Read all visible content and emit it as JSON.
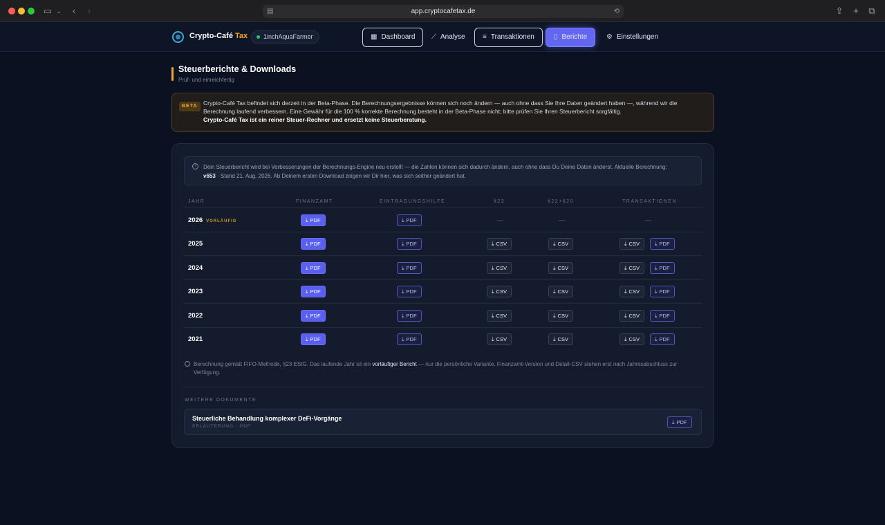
{
  "browser": {
    "url": "app.cryptocafetax.de"
  },
  "nav": {
    "brand": "Crypto-Café",
    "brand_suffix": "Tax",
    "user": "1inchAquaFarmer",
    "items": [
      {
        "label": "Dashboard",
        "icon": "grid-icon",
        "state": "outline"
      },
      {
        "label": "Analyse",
        "icon": "chart-icon",
        "state": "plain"
      },
      {
        "label": "Transaktionen",
        "icon": "list-icon",
        "state": "outline"
      },
      {
        "label": "Berichte",
        "icon": "document-icon",
        "state": "active"
      },
      {
        "label": "Einstellungen",
        "icon": "gear-icon",
        "state": "plain"
      }
    ]
  },
  "page": {
    "title": "Steuerberichte & Downloads",
    "subtitle": "Prüf- und einreichfertig"
  },
  "beta": {
    "badge": "BETA",
    "text": "Crypto-Café Tax befindet sich derzeit in der Beta-Phase. Die Berechnungsergebnisse können sich noch ändern — auch ohne dass Sie Ihre Daten geändert haben —, während wir die Berechnung laufend verbessern. Eine Gewähr für die 100 % korrekte Berechnung besteht in der Beta-Phase nicht; bitte prüfen Sie Ihren Steuerbericht sorgfältig.",
    "strong": "Crypto-Café Tax ist ein reiner Steuer-Rechner und ersetzt keine Steuerberatung."
  },
  "info": {
    "text1": "Dein Steuerbericht wird bei Verbesserungen der Berechnungs-Engine neu erstellt — die Zahlen können sich dadurch ändern, auch ohne dass Du Deine Daten änderst. Aktuelle Berechnung:",
    "version": "v653",
    "text2": " · Stand 21. Aug. 2026. Ab Deinem ersten Download zeigen wir Dir hier, was sich seither geändert hat."
  },
  "table": {
    "headers": {
      "year": "JAHR",
      "finanzamt": "FINANZAMT",
      "eintragungshilfe": "EINTRAGUNGSHILFE",
      "p23": "§23",
      "p22": "§22+§20",
      "tx": "TRANSAKTIONEN"
    },
    "pdf_label": "PDF",
    "csv_label": "CSV",
    "dash": "—",
    "prelim_label": "VORLÄUFIG",
    "rows": [
      {
        "year": "2026",
        "prelim": true
      },
      {
        "year": "2025",
        "prelim": false
      },
      {
        "year": "2024",
        "prelim": false
      },
      {
        "year": "2023",
        "prelim": false
      },
      {
        "year": "2022",
        "prelim": false
      },
      {
        "year": "2021",
        "prelim": false
      }
    ]
  },
  "footnote": {
    "text1": "Berechnung gemäß FIFO-Methode, §23 EStG. Das laufende Jahr ist ein ",
    "bold": "vorläufiger Bericht",
    "text2": " — nur die persönliche Variante, Finanzamt-Version und Detail-CSV stehen erst nach Jahresabschluss zur Verfügung."
  },
  "more": {
    "label": "WEITERE DOKUMENTE",
    "doc_title": "Steuerliche Behandlung komplexer DeFi-Vorgänge",
    "doc_sub": "ERLÄUTERUNG · PDF",
    "doc_btn": "PDF"
  }
}
